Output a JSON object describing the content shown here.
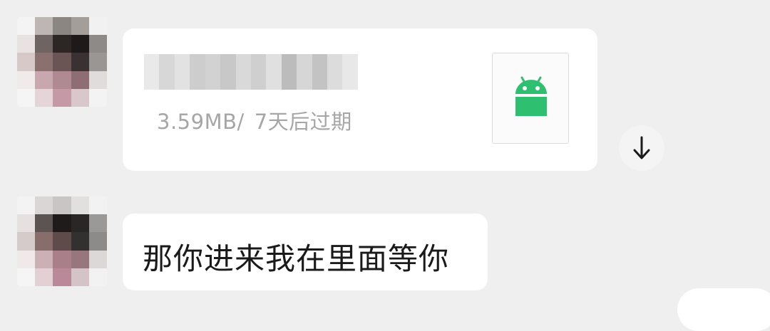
{
  "messages": [
    {
      "type": "file",
      "file_size": "3.59MB/",
      "expiry": "7天后过期",
      "file_icon": "android-icon",
      "action_icon": "download-arrow-icon"
    },
    {
      "type": "text",
      "text": "那你进来我在里面等你"
    }
  ],
  "colors": {
    "background": "#efefef",
    "bubble": "#ffffff",
    "android_green": "#2fbf71",
    "meta_text": "#a6a6a6",
    "message_text": "#1a1a1a"
  }
}
